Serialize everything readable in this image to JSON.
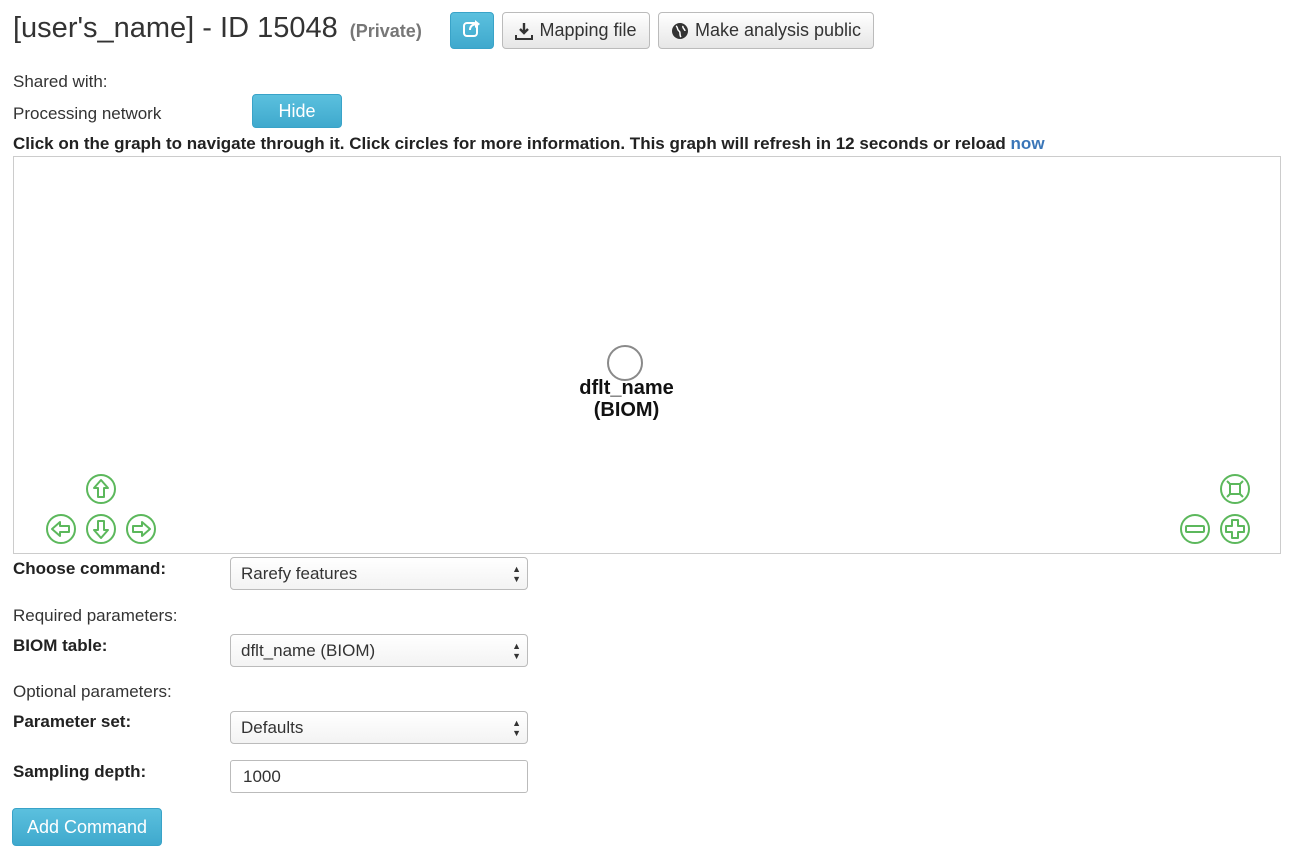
{
  "header": {
    "title": "[user's_name] - ID 15048",
    "visibility": "(Private)",
    "mapping_file_label": "Mapping file",
    "make_public_label": "Make analysis public"
  },
  "shared_with_label": "Shared with:",
  "processing_network": {
    "label": "Processing network",
    "hide_label": "Hide"
  },
  "instructions": {
    "text": "Click on the graph to navigate through it. Click circles for more information. This graph will refresh in 12 seconds or reload",
    "link": "now"
  },
  "graph": {
    "node_name": "dflt_name",
    "node_type": "(BIOM)"
  },
  "form": {
    "choose_command_label": "Choose command:",
    "command_value": "Rarefy features",
    "required_label": "Required parameters:",
    "biom_label": "BIOM table:",
    "biom_value": "dflt_name (BIOM)",
    "optional_label": "Optional parameters:",
    "parameter_set_label": "Parameter set:",
    "parameter_set_value": "Defaults",
    "sampling_depth_label": "Sampling depth:",
    "sampling_depth_value": "1000",
    "add_command_label": "Add Command"
  },
  "colors": {
    "accent": "#5bc0de",
    "link": "#3a76b8",
    "nav_green": "#5cb85c"
  }
}
